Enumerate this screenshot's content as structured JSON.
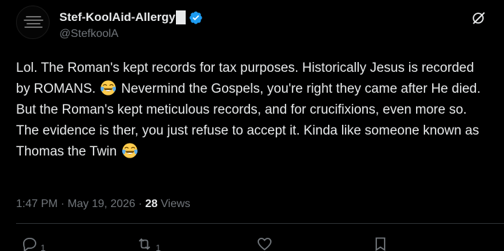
{
  "author": {
    "display_name": "Stef-KoolAid-Allergy",
    "handle": "@StefkoolA",
    "verified": true,
    "verified_color": "#1d9bf0"
  },
  "tweet": {
    "paragraph1": {
      "part1": "Lol. The Roman's kept records for tax purposes. Historically Jesus is recorded by ROMANS.",
      "emoji1": "face-with-tears-of-joy",
      "part2": "Nevermind the Gospels, you're right they came after He died. But the Roman's kept meticulous records, and for crucifixions, even more so."
    },
    "paragraph2": {
      "part1": "The evidence is ther, you just refuse to accept it. Kinda like someone known as Thomas the Twin",
      "emoji2": "face-with-tears-of-joy"
    }
  },
  "meta": {
    "time": "1:47 PM",
    "separator": "·",
    "date": "May 19, 2026",
    "views_count": "28",
    "views_label": "Views"
  },
  "actions": {
    "replies": "1",
    "reposts": "1"
  },
  "icons": {
    "grok": "grok-icon",
    "reply": "reply-icon",
    "repost": "repost-icon",
    "like": "heart-icon",
    "bookmark": "bookmark-icon"
  },
  "colors": {
    "background": "#000000",
    "text": "#e7e9ea",
    "secondary": "#71767b",
    "divider": "#2f3336",
    "accent": "#1d9bf0"
  }
}
